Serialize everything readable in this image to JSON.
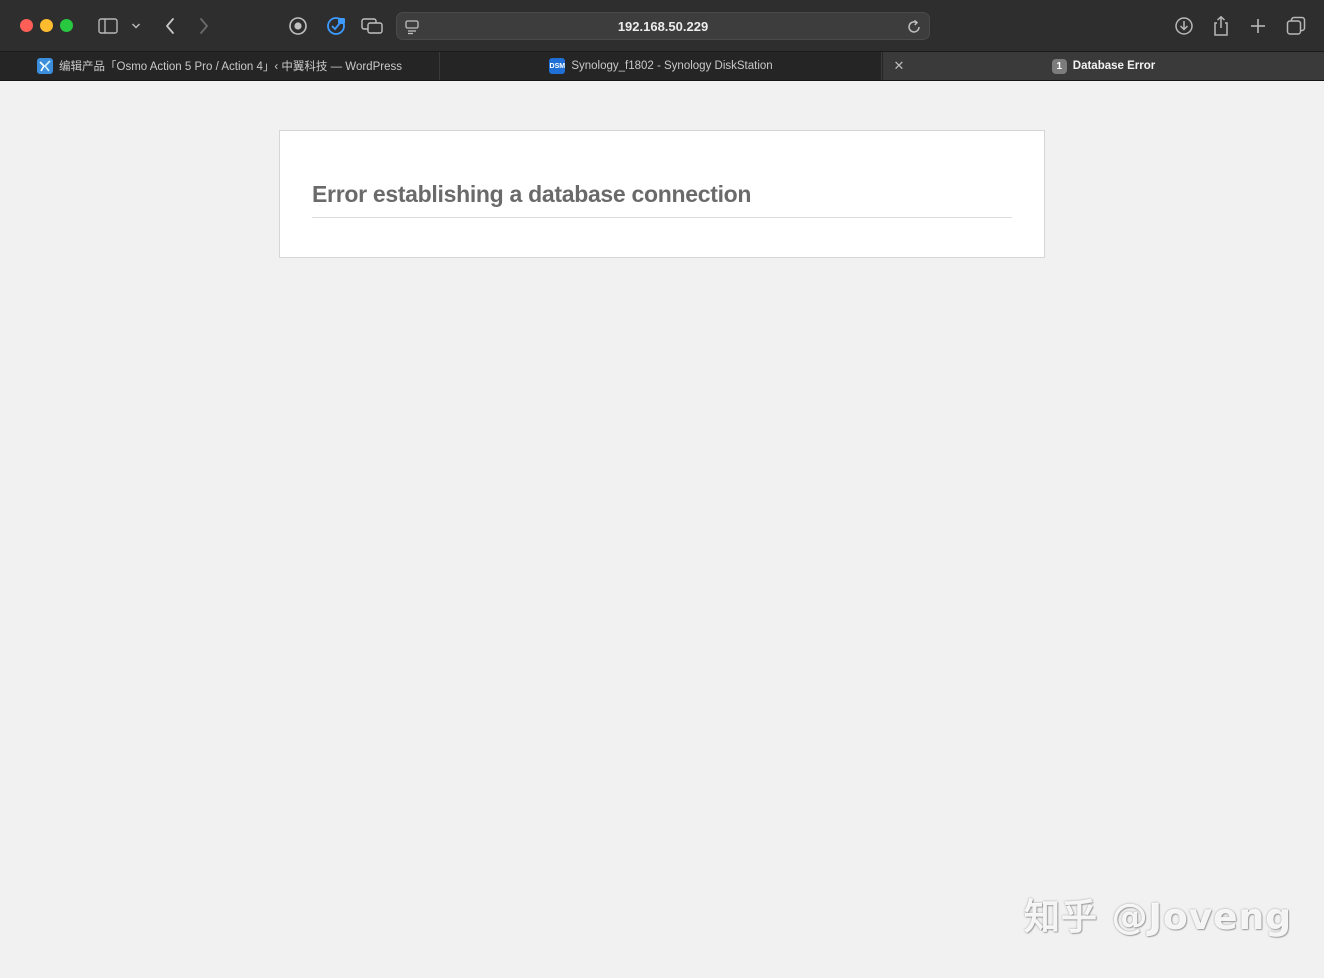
{
  "browser": {
    "address_bar": {
      "url": "192.168.50.229"
    },
    "tabs": [
      {
        "label": "编辑产品「Osmo Action 5 Pro / Action 4」‹ 中翼科技 — WordPress",
        "favicon": "wordpress-site-icon"
      },
      {
        "label": "Synology_f1802 - Synology DiskStation",
        "favicon_text": "DSM"
      },
      {
        "label": "Database Error",
        "badge": "1",
        "active": true
      }
    ],
    "toolbar_icons": [
      "sidebar-icon",
      "chevron-down-icon",
      "back-icon",
      "forward-icon",
      "record-icon",
      "extension-icon",
      "tab-overview-icon",
      "page-menu-icon",
      "reload-icon",
      "download-icon",
      "share-icon",
      "new-tab-icon",
      "tabs-icon"
    ]
  },
  "page": {
    "error_message": "Error establishing a database connection"
  },
  "watermark": {
    "text": "知乎 @Joveng"
  },
  "colors": {
    "page_bg": "#f1f1f1",
    "title_text": "#6a6a6a",
    "chrome_bg": "#2e2e2e"
  }
}
